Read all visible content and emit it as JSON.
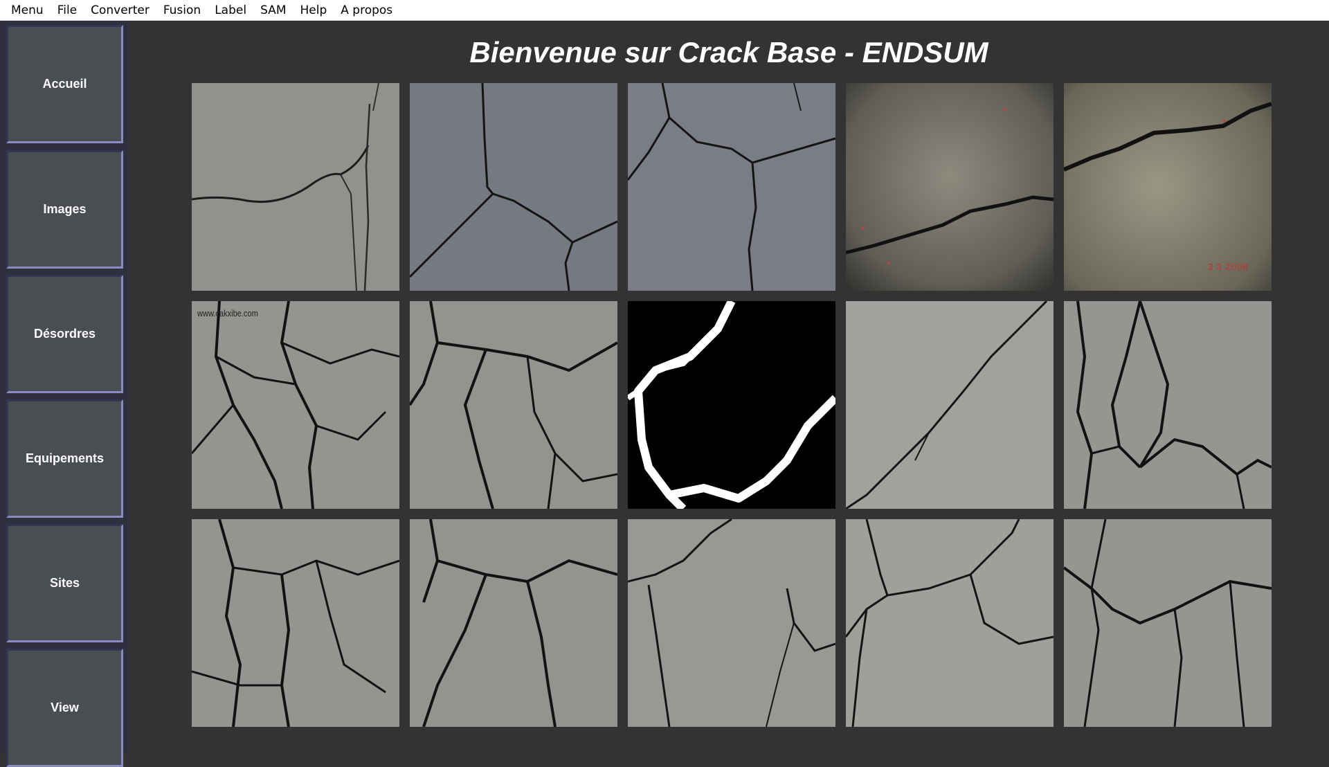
{
  "menu": {
    "items": [
      "Menu",
      "File",
      "Converter",
      "Fusion",
      "Label",
      "SAM",
      "Help",
      "A propos"
    ]
  },
  "sidebar": {
    "buttons": [
      "Accueil",
      "Images",
      "Désordres",
      "Equipements",
      "Sites",
      "View"
    ]
  },
  "main": {
    "title": "Bienvenue sur Crack Base - ENDSUM"
  },
  "gallery": {
    "watermark": "www.cakxibe.com",
    "date_stamp": "3  3 2008"
  },
  "colors": {
    "background": "#333333",
    "sidebar": "#2f2f3e",
    "button": "#4a4d52",
    "button_border_light": "#8b8bc4"
  }
}
